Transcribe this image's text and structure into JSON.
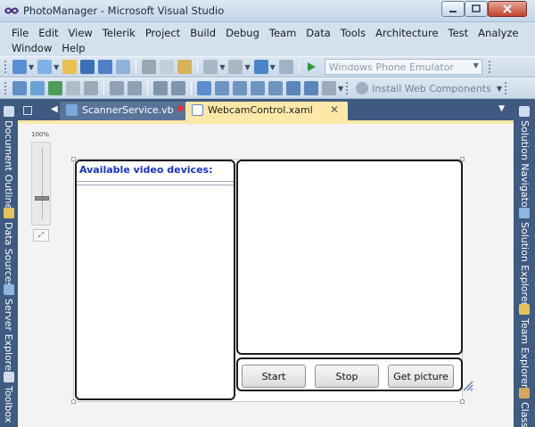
{
  "window": {
    "title": "PhotoManager - Microsoft Visual Studio"
  },
  "menu": {
    "row1": [
      "File",
      "Edit",
      "View",
      "Telerik",
      "Project",
      "Build",
      "Debug",
      "Team",
      "Data",
      "Tools",
      "Architecture",
      "Test",
      "Analyze"
    ],
    "row2": [
      "Window",
      "Help"
    ]
  },
  "toolbar": {
    "emulator": "Windows Phone Emulator",
    "install": "Install Web Components"
  },
  "left_dock": {
    "outline": "Document Outline",
    "sources": "Data Sources",
    "server": "Server Explorer",
    "toolbox": "Toolbox"
  },
  "right_dock": {
    "navigator": "Solution Navigator",
    "explorer": "Solution Explorer",
    "team": "Team Explorer",
    "classes": "Class"
  },
  "tabs": [
    {
      "label": "ScannerService.vb",
      "active": false,
      "modified": true
    },
    {
      "label": "WebcamControl.xaml",
      "active": true
    }
  ],
  "designer": {
    "zoom_label": "100%",
    "zoom_level_percent": 100,
    "devices_header": "Available video devices:",
    "buttons": {
      "start": "Start",
      "stop": "Stop",
      "get_picture": "Get picture"
    }
  },
  "colors": {
    "accent_tab": "#fde8a8",
    "dock_strip": "#3f5b82",
    "header_text": "#1434c8"
  }
}
